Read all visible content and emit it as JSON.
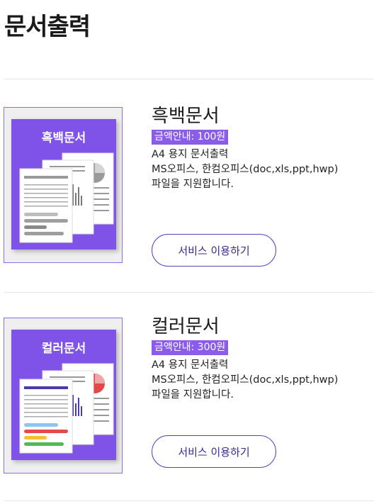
{
  "page": {
    "title": "문서출력"
  },
  "services": [
    {
      "thumb_label": "흑백문서",
      "title": "흑백문서",
      "price": "금액안내: 100원",
      "desc_line1": "A4 용지 문서출력",
      "desc_line2": "MS오피스, 한컴오피스(doc,xls,ppt,hwp)",
      "desc_line3": "파일을 지원합니다.",
      "button": "서비스 이용하기",
      "colors": {
        "accent": "#9a9a9a",
        "chart": "#888888",
        "bars": [
          "#bdbdbd",
          "#9e9e9e",
          "#8a8a8a"
        ]
      }
    },
    {
      "thumb_label": "컬러문서",
      "title": "컬러문서",
      "price": "금액안내: 300원",
      "desc_line1": "A4 용지 문서출력",
      "desc_line2": "MS오피스, 한컴오피스(doc,xls,ppt,hwp)",
      "desc_line3": "파일을 지원합니다.",
      "button": "서비스 이용하기",
      "colors": {
        "accent": "#4b3ba8",
        "chart": "#e2474b",
        "bars": [
          "#8ec5f0",
          "#e8474b",
          "#f2c230",
          "#56b65a"
        ]
      }
    }
  ],
  "theme": {
    "primary": "#8a5ce8",
    "thumb_bg": "#7f52e8",
    "button_border": "#5b3fb8"
  }
}
